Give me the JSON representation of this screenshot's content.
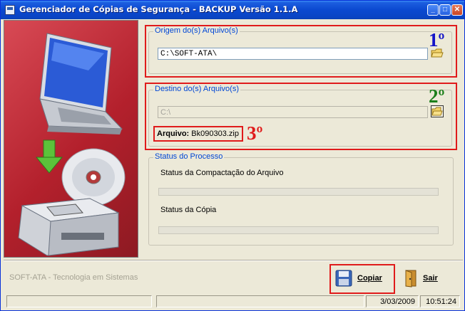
{
  "window": {
    "title": "Gerenciador de Cópias de Segurança - BACKUP Versão 1.1.A"
  },
  "origem": {
    "legend": "Origem do(s) Arquivo(s)",
    "path": "C:\\SOFT-ATA\\",
    "step": "1º",
    "step_color": "#1414c8"
  },
  "destino": {
    "legend": "Destino do(s) Arquivo(s)",
    "path": "C:\\",
    "step": "2º",
    "step_color": "#1a7f1a",
    "arquivo_label": "Arquivo:",
    "arquivo_value": "Bk090303.zip",
    "arquivo_step": "3º",
    "arquivo_step_color": "#e01b1b"
  },
  "status": {
    "legend": "Status do Processo",
    "compactacao_label": "Status da Compactação do Arquivo",
    "compactacao_progress": 0,
    "copia_label": "Status da Cópia",
    "copia_progress": 0
  },
  "footer": {
    "company": "SOFT-ATA - Tecnologia em Sistemas",
    "copiar_label": "Copiar",
    "sair_label": "Sair"
  },
  "statusbar": {
    "date": "3/03/2009",
    "time": "10:51:24"
  },
  "colors": {
    "highlight_border": "#e01b1b",
    "legend_text": "#0046d5"
  }
}
